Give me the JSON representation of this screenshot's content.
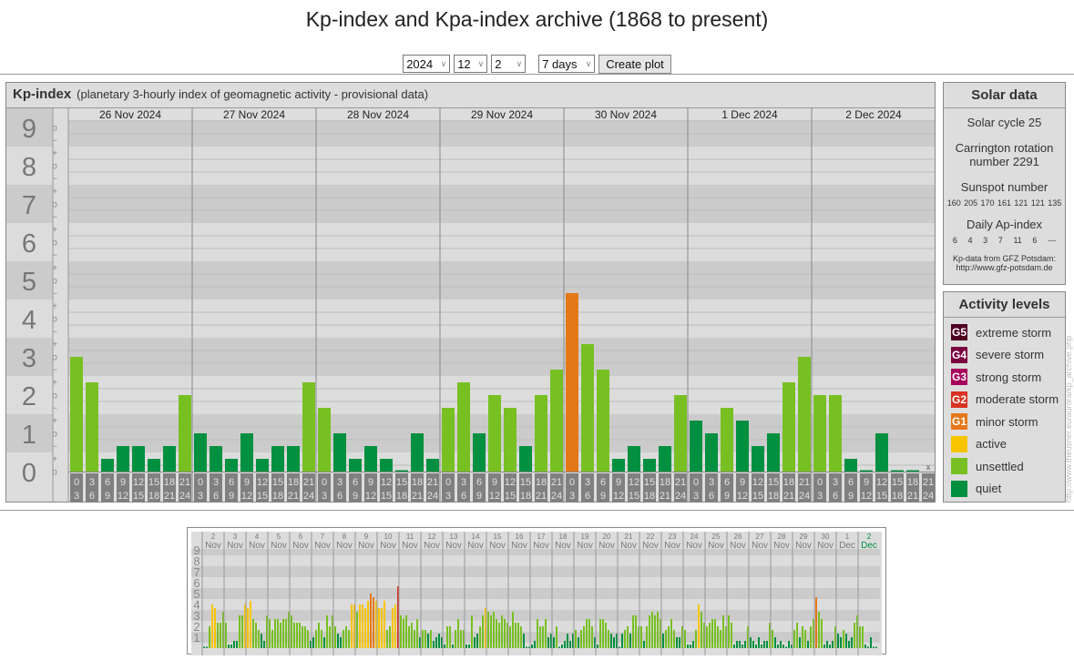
{
  "title": "Kp-index and Kpa-index archive (1868 to present)",
  "controls": {
    "year": "2024",
    "month": "12",
    "day": "2",
    "range": "7 days",
    "create_plot_label": "Create plot"
  },
  "kp_panel": {
    "title": "Kp-index",
    "subtitle": "(planetary 3-hourly index of geomagnetic activity - provisional data)",
    "axis_levels": [
      "0",
      "1",
      "2",
      "3",
      "4",
      "5",
      "6",
      "7",
      "8",
      "9"
    ],
    "sub_marks": [
      "−",
      "o",
      "+"
    ],
    "time_slots": [
      [
        "0",
        "3"
      ],
      [
        "3",
        "6"
      ],
      [
        "6",
        "9"
      ],
      [
        "9",
        "12"
      ],
      [
        "12",
        "15"
      ],
      [
        "15",
        "18"
      ],
      [
        "18",
        "21"
      ],
      [
        "21",
        "24"
      ]
    ],
    "missing_mark": "x",
    "days": [
      {
        "date": "26 Nov 2024",
        "kp": [
          "3o",
          "2+",
          "0+",
          "1-",
          "1-",
          "0+",
          "1-",
          "2o"
        ]
      },
      {
        "date": "27 Nov 2024",
        "kp": [
          "1o",
          "1-",
          "0+",
          "1o",
          "0+",
          "1-",
          "1-",
          "2+"
        ]
      },
      {
        "date": "28 Nov 2024",
        "kp": [
          "2-",
          "1o",
          "0+",
          "1-",
          "0+",
          "0o",
          "1o",
          "0+"
        ]
      },
      {
        "date": "29 Nov 2024",
        "kp": [
          "2-",
          "2+",
          "1o",
          "2o",
          "2-",
          "1-",
          "2o",
          "3-"
        ]
      },
      {
        "date": "30 Nov 2024",
        "kp": [
          "5-",
          "3+",
          "3-",
          "0+",
          "1-",
          "0+",
          "1-",
          "2o"
        ]
      },
      {
        "date": "1 Dec 2024",
        "kp": [
          "1+",
          "1o",
          "2-",
          "1+",
          "1-",
          "1o",
          "2+",
          "3o"
        ]
      },
      {
        "date": "2 Dec 2024",
        "kp": [
          "2o",
          "2o",
          "0+",
          "0o",
          "1o",
          "0o",
          "0o",
          "x"
        ]
      }
    ]
  },
  "solar_data": {
    "title": "Solar data",
    "solar_cycle": "Solar cycle 25",
    "carrington_line1": "Carrington rotation",
    "carrington_line2": "number 2291",
    "sunspot_label": "Sunspot number",
    "sunspot_values": [
      "160",
      "205",
      "170",
      "161",
      "121",
      "121",
      "135"
    ],
    "ap_label": "Daily Ap-index",
    "ap_values": [
      "6",
      "4",
      "3",
      "7",
      "11",
      "6",
      "---"
    ],
    "source_line1": "Kp-data from  GFZ Potsdam:",
    "source_line2": "http://www.gfz-potsdam.de"
  },
  "activity_levels": {
    "title": "Activity levels",
    "items": [
      {
        "badge": "G5",
        "label": "extreme storm",
        "color": "#4e0020"
      },
      {
        "badge": "G4",
        "label": "severe storm",
        "color": "#7a0040"
      },
      {
        "badge": "G3",
        "label": "strong storm",
        "color": "#a8005a"
      },
      {
        "badge": "G2",
        "label": "moderate storm",
        "color": "#d83222"
      },
      {
        "badge": "G1",
        "label": "minor storm",
        "color": "#e47818"
      },
      {
        "badge": "",
        "label": "active",
        "color": "#f8c400"
      },
      {
        "badge": "",
        "label": "unsettled",
        "color": "#78c022"
      },
      {
        "badge": "",
        "label": "quiet",
        "color": "#00903f"
      }
    ]
  },
  "vertical_url": "http://www.theusner.eu/aurora/kp_archive.php",
  "mini_chart": {
    "value_unit": "thirds of Kp (3 = 1o)",
    "current_day_color": "#00903f",
    "days": [
      {
        "day": "2",
        "month": "Nov",
        "v": [
          0,
          0,
          6,
          12,
          11,
          7,
          7,
          10
        ]
      },
      {
        "day": "3",
        "month": "Nov",
        "v": [
          7,
          1,
          1,
          2,
          2,
          9,
          9,
          12
        ]
      },
      {
        "day": "4",
        "month": "Nov",
        "v": [
          11,
          13,
          8,
          7,
          5,
          4,
          2,
          9
        ]
      },
      {
        "day": "5",
        "month": "Nov",
        "v": [
          8,
          5,
          8,
          8,
          7,
          8,
          8,
          10
        ]
      },
      {
        "day": "6",
        "month": "Nov",
        "v": [
          9,
          7,
          7,
          7,
          6,
          6,
          5,
          2
        ]
      },
      {
        "day": "7",
        "month": "Nov",
        "v": [
          3,
          5,
          7,
          5,
          3,
          9,
          6,
          9
        ]
      },
      {
        "day": "8",
        "month": "Nov",
        "v": [
          6,
          4,
          3,
          5,
          6,
          5,
          12,
          12
        ]
      },
      {
        "day": "9",
        "month": "Nov",
        "v": [
          10,
          12,
          12,
          11,
          13,
          15,
          14,
          13
        ]
      },
      {
        "day": "10",
        "month": "Nov",
        "v": [
          11,
          11,
          13,
          5,
          6,
          11,
          12,
          17
        ]
      },
      {
        "day": "11",
        "month": "Nov",
        "v": [
          9,
          8,
          9,
          6,
          7,
          5,
          8,
          3
        ]
      },
      {
        "day": "12",
        "month": "Nov",
        "v": [
          5,
          5,
          4,
          5,
          2,
          3,
          4,
          3
        ]
      },
      {
        "day": "13",
        "month": "Nov",
        "v": [
          1,
          6,
          6,
          1,
          5,
          8,
          5,
          5
        ]
      },
      {
        "day": "14",
        "month": "Nov",
        "v": [
          1,
          1,
          9,
          3,
          4,
          6,
          9,
          11
        ]
      },
      {
        "day": "15",
        "month": "Nov",
        "v": [
          10,
          9,
          10,
          8,
          7,
          9,
          8,
          7
        ]
      },
      {
        "day": "16",
        "month": "Nov",
        "v": [
          6,
          10,
          7,
          7,
          6,
          4,
          0,
          0
        ]
      },
      {
        "day": "17",
        "month": "Nov",
        "v": [
          1,
          2,
          8,
          6,
          6,
          8,
          3,
          4
        ]
      },
      {
        "day": "18",
        "month": "Nov",
        "v": [
          3,
          6,
          0,
          1,
          2,
          4,
          2,
          4
        ]
      },
      {
        "day": "19",
        "month": "Nov",
        "v": [
          5,
          3,
          5,
          6,
          8,
          8,
          6,
          3
        ]
      },
      {
        "day": "20",
        "month": "Nov",
        "v": [
          1,
          8,
          8,
          7,
          5,
          4,
          3,
          4
        ]
      },
      {
        "day": "21",
        "month": "Nov",
        "v": [
          0,
          4,
          5,
          6,
          4,
          9,
          9,
          6
        ]
      },
      {
        "day": "22",
        "month": "Nov",
        "v": [
          6,
          2,
          6,
          9,
          10,
          9,
          10,
          8
        ]
      },
      {
        "day": "23",
        "month": "Nov",
        "v": [
          4,
          5,
          6,
          8,
          5,
          3,
          3,
          6
        ]
      },
      {
        "day": "24",
        "month": "Nov",
        "v": [
          5,
          1,
          1,
          2,
          5,
          12,
          10,
          7
        ]
      },
      {
        "day": "25",
        "month": "Nov",
        "v": [
          6,
          7,
          8,
          8,
          6,
          5,
          9,
          6
        ]
      },
      {
        "day": "26",
        "month": "Nov",
        "v": [
          9,
          7,
          1,
          2,
          2,
          1,
          2,
          6
        ]
      },
      {
        "day": "27",
        "month": "Nov",
        "v": [
          3,
          2,
          1,
          3,
          1,
          2,
          2,
          7
        ]
      },
      {
        "day": "28",
        "month": "Nov",
        "v": [
          5,
          3,
          1,
          2,
          1,
          0,
          2,
          1
        ]
      },
      {
        "day": "29",
        "month": "Nov",
        "v": [
          5,
          7,
          3,
          6,
          5,
          2,
          6,
          8
        ]
      },
      {
        "day": "30",
        "month": "Nov",
        "v": [
          14,
          10,
          8,
          1,
          2,
          1,
          2,
          6
        ]
      },
      {
        "day": "1",
        "month": "Dec",
        "v": [
          4,
          3,
          5,
          4,
          2,
          3,
          7,
          9
        ]
      },
      {
        "day": "2",
        "month": "Dec",
        "v": [
          6,
          6,
          1,
          0,
          3,
          0,
          0,
          null
        ]
      }
    ]
  }
}
